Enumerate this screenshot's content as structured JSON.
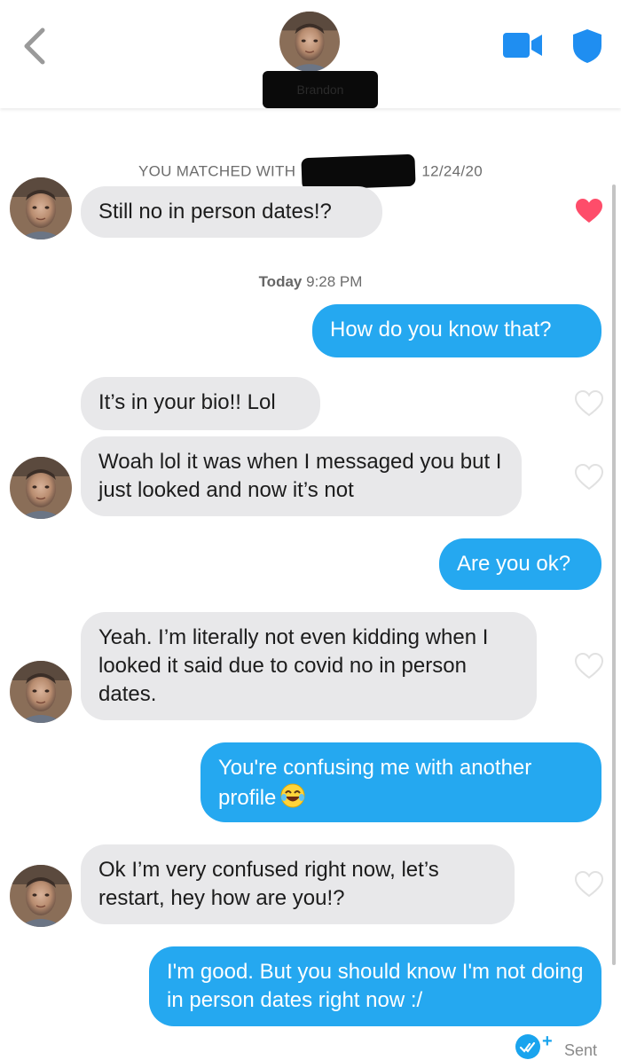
{
  "header": {
    "name": "Brandon"
  },
  "match_notice": {
    "prefix": "YOU MATCHED WITH",
    "suffix": "12/24/20"
  },
  "timestamp": {
    "day": "Today",
    "time": "9:28 PM"
  },
  "messages": [
    {
      "from": "them",
      "text": "Still no in person dates!?",
      "liked": true
    },
    {
      "from": "me",
      "text": "How do you know that?"
    },
    {
      "from": "them",
      "text": "It’s in your bio!! Lol",
      "liked": false
    },
    {
      "from": "them",
      "text": "Woah lol it was when I messaged you but I just looked and now it’s not",
      "liked": false
    },
    {
      "from": "me",
      "text": "Are you ok?"
    },
    {
      "from": "them",
      "text": "Yeah. I’m literally not even kidding when I looked it said due to covid no in person dates.",
      "liked": false
    },
    {
      "from": "me",
      "text": "You're confusing me with another profile",
      "emoji": "laughing-tears-emoji"
    },
    {
      "from": "them",
      "text": "Ok I’m very confused right now, let’s restart, hey how are you!?",
      "liked": false
    },
    {
      "from": "me",
      "text": "I'm good. But you should know I'm not doing in person dates right now :/"
    }
  ],
  "status": {
    "sent_label": "Sent",
    "plus": "+"
  },
  "colors": {
    "outgoing": "#25a8f0",
    "incoming": "#e8e8ea",
    "heart_liked": "#fe4d6a",
    "icon_blue": "#1f8ef1"
  }
}
